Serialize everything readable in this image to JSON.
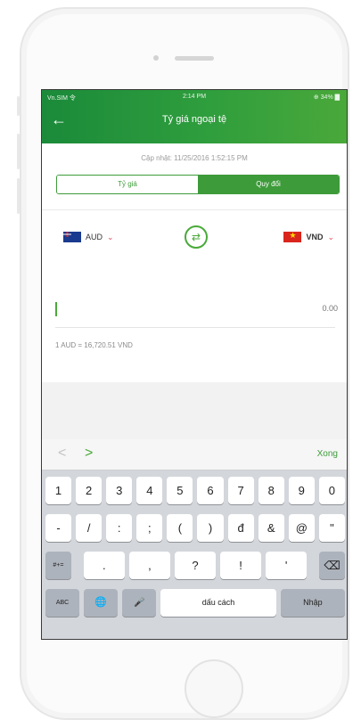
{
  "status_bar": {
    "carrier": "Vn.SIM 令",
    "time": "2:14 PM",
    "battery": "⊕ 34% ▇"
  },
  "header": {
    "title": "Tỷ giá ngoại tệ",
    "back_icon": "arrow-left-icon"
  },
  "updated_text": "Cập nhật: 11/25/2016 1:52:15 PM",
  "tabs": [
    {
      "label": "Tỷ giá",
      "active": false
    },
    {
      "label": "Quy đổi",
      "active": true
    }
  ],
  "from_currency": {
    "code": "AUD",
    "flag": "australia-flag"
  },
  "to_currency": {
    "code": "VND",
    "flag": "vietnam-flag"
  },
  "swap_icon": "swap-icon",
  "amount_placeholder": "0.00",
  "rate_text": "1 AUD = 16,720.51 VND",
  "keyboard": {
    "accessory": {
      "prev": "<",
      "next": ">",
      "done": "Xong"
    },
    "row1": [
      "1",
      "2",
      "3",
      "4",
      "5",
      "6",
      "7",
      "8",
      "9",
      "0"
    ],
    "row2": [
      "-",
      "/",
      ":",
      ";",
      "(",
      ")",
      "đ",
      "&",
      "@",
      "\""
    ],
    "row3": {
      "mode": "#+=",
      "keys": [
        ".",
        ",",
        "?",
        "!",
        "'"
      ],
      "delete": "⌫"
    },
    "row4": {
      "abc": "ABC",
      "globe": "🌐",
      "mic": "🎤",
      "space": "dấu cách",
      "return": "Nhập"
    }
  },
  "colors": {
    "brand_green": "#3d9b3a",
    "header_dark": "#1b8a3a"
  }
}
